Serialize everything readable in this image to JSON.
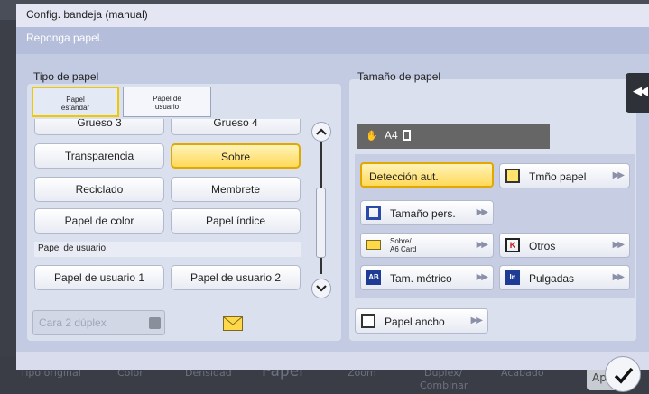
{
  "background": {
    "tabs": [
      "Tipo original",
      "Color",
      "Densidad",
      "Papel",
      "Zoom",
      "Dúplex/",
      "Acabado"
    ],
    "tab_line2": "Combinar",
    "ok_partial": "Ap"
  },
  "dialog": {
    "title": "Config. bandeja (manual)",
    "message": "Reponga papel."
  },
  "paper_type": {
    "label": "Tipo de papel",
    "tabs": [
      "Papel estándar",
      "Papel de usuario"
    ],
    "buttons": [
      {
        "label": "Grueso 3",
        "selected": false
      },
      {
        "label": "Grueso 4",
        "selected": false
      },
      {
        "label": "Transparencia",
        "selected": false
      },
      {
        "label": "Sobre",
        "selected": true
      },
      {
        "label": "Reciclado",
        "selected": false
      },
      {
        "label": "Membrete",
        "selected": false
      },
      {
        "label": "Papel de color",
        "selected": false
      },
      {
        "label": "Papel índice",
        "selected": false
      }
    ],
    "user_section_label": "Papel de usuario",
    "user_buttons": [
      {
        "label": "Papel de usuario 1"
      },
      {
        "label": "Papel de usuario 2"
      }
    ],
    "duplex": "Cara 2 dúplex"
  },
  "paper_size": {
    "label": "Tamaño de papel",
    "current": "A4",
    "buttons": {
      "auto": "Detección aut.",
      "size": "Tmño papel",
      "custom": "Tamaño pers.",
      "envelope_line1": "Sobre/",
      "envelope_line2": "A6 Card",
      "others": "Otros",
      "metric": "Tam. métrico",
      "inches": "Pulgadas",
      "wide": "Papel ancho"
    }
  },
  "colors": {
    "accent": "#f0c800",
    "selected_fill": "#ffd95a",
    "panel": "#dbe0ef"
  }
}
